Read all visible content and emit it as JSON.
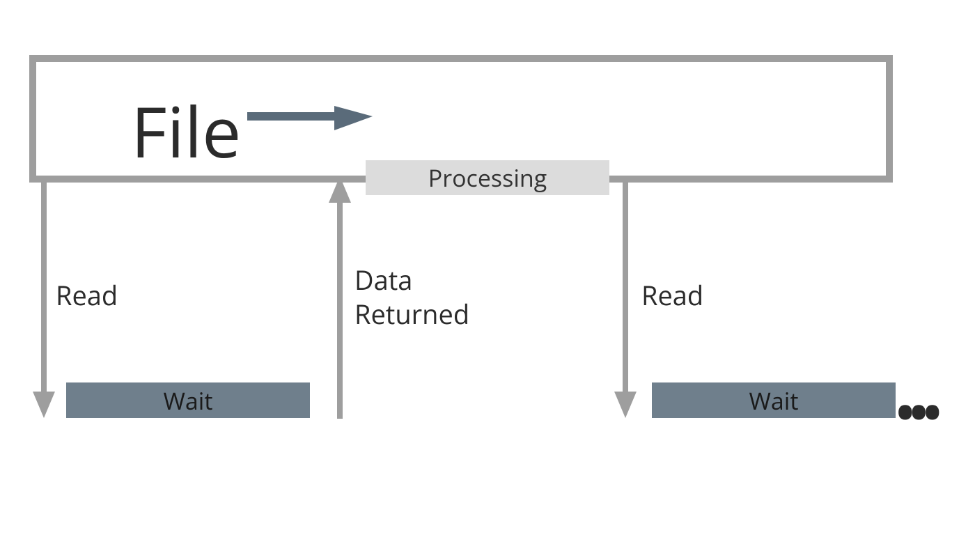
{
  "file_label": "File",
  "processing_label": "Processing",
  "wait_label_1": "Wait",
  "wait_label_2": "Wait",
  "read_label_1": "Read",
  "read_label_2": "Read",
  "data_returned_label_line1": "Data",
  "data_returned_label_line2": "Returned",
  "ellipsis": "•••",
  "colors": {
    "box_border": "#9e9e9e",
    "processing_bg": "#dcdcdc",
    "wait_bg": "#6f7f8c",
    "arrow_fill": "#9e9e9e",
    "file_arrow_fill": "#5a6b7a"
  }
}
